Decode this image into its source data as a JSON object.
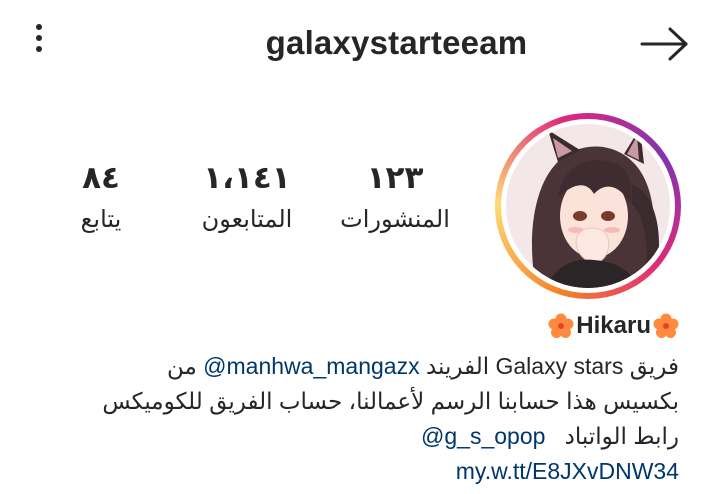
{
  "header": {
    "username": "galaxystarteeam",
    "menu_icon": "more-vertical-icon",
    "back_icon": "arrow-right-icon"
  },
  "profile": {
    "avatar_icon": "profile-avatar-anime-girl",
    "stats": {
      "posts": {
        "value": "١٢٣",
        "label": "المنشورات"
      },
      "followers": {
        "value": "١،١٤١",
        "label": "المتابعون"
      },
      "following": {
        "value": "٨٤",
        "label": "يتابع"
      }
    }
  },
  "bio": {
    "name": "Hikaru",
    "name_emoji": "hibiscus-flower",
    "line1_prefix": "فريق ",
    "line1_brand": "Galaxy stars",
    "line1_mid": " الفريند ",
    "line1_mention": "@manhwa_mangazx",
    "line1_suffix": " من",
    "line2": "بكسيس هذا حسابنا الرسم لأعمالنا، حساب الفريق للكوميكس",
    "line3_mention": "@g_s_opop",
    "line3_text": "رابط الواتباد",
    "link": "my.w.tt/E8JXvDNW34"
  },
  "colors": {
    "text": "#262626",
    "link": "#00376b",
    "story_ring": [
      "#f58529",
      "#dd2a7b",
      "#8134af"
    ]
  }
}
